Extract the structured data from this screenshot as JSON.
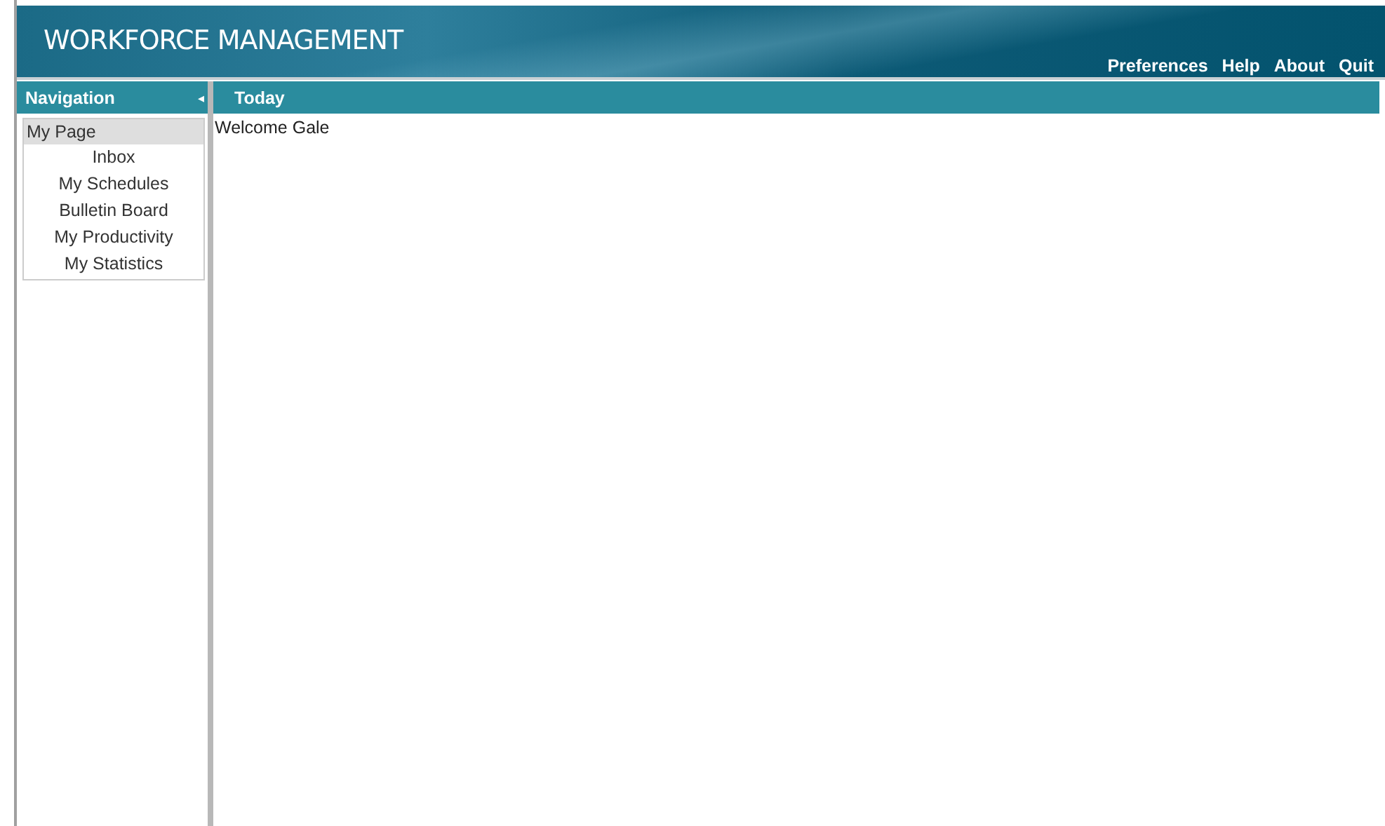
{
  "header": {
    "title": "WORKFORCE MANAGEMENT",
    "links": [
      "Preferences",
      "Help",
      "About",
      "Quit"
    ]
  },
  "navigation": {
    "title": "Navigation",
    "collapse_icon": "◂",
    "items": [
      {
        "label": "My Page",
        "selected": true,
        "children": [
          {
            "label": "Inbox",
            "selected": false
          },
          {
            "label": "My Schedules",
            "selected": false
          },
          {
            "label": "Bulletin Board",
            "selected": false
          },
          {
            "label": "My Productivity",
            "selected": false
          },
          {
            "label": "My Statistics",
            "selected": false
          }
        ]
      }
    ]
  },
  "main": {
    "title": "Today",
    "welcome": "Welcome Gale"
  }
}
